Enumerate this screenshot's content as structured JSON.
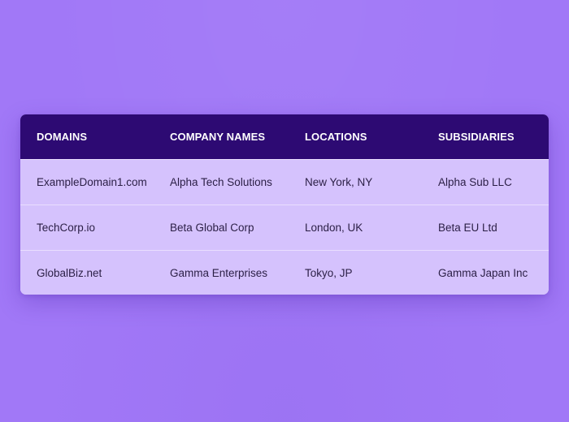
{
  "colors": {
    "background": "#a178f7",
    "header_background": "#2d0a73",
    "row_background": "#d5c2fd",
    "header_text": "#ffffff",
    "body_text": "#2b1f45"
  },
  "table": {
    "headers": [
      "DOMAINS",
      "COMPANY NAMES",
      "LOCATIONS",
      "SUBSIDIARIES"
    ],
    "rows": [
      [
        "ExampleDomain1.com",
        "Alpha Tech Solutions",
        "New York, NY",
        "Alpha Sub LLC"
      ],
      [
        "TechCorp.io",
        "Beta Global Corp",
        "London, UK",
        "Beta EU Ltd"
      ],
      [
        "GlobalBiz.net",
        "Gamma Enterprises",
        "Tokyo, JP",
        "Gamma Japan Inc"
      ]
    ]
  }
}
